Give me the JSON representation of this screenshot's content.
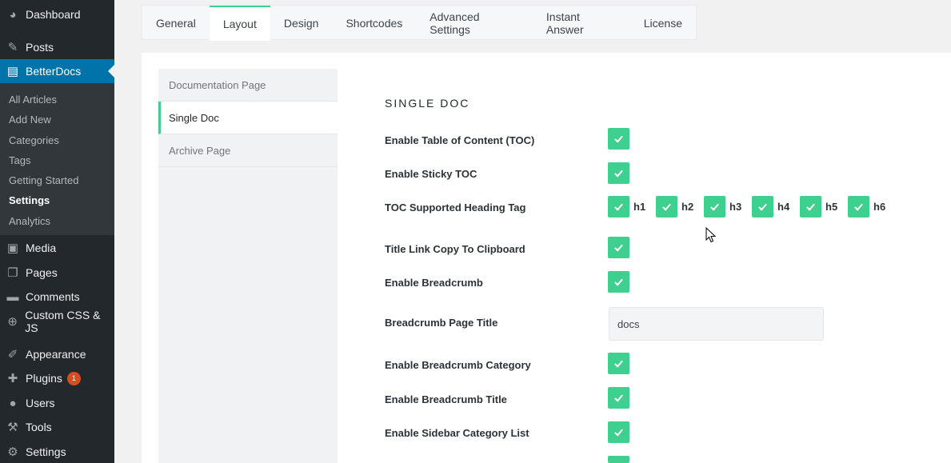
{
  "sidebar": {
    "items": [
      {
        "label": "Dashboard",
        "icon": "dashboard-icon",
        "glyph": "◕"
      },
      {
        "label": "Posts",
        "icon": "pin-icon",
        "glyph": "✎"
      },
      {
        "label": "BetterDocs",
        "icon": "document-icon",
        "glyph": "▤"
      },
      {
        "label": "Media",
        "icon": "media-icon",
        "glyph": "▣"
      },
      {
        "label": "Pages",
        "icon": "pages-icon",
        "glyph": "❐"
      },
      {
        "label": "Comments",
        "icon": "comment-icon",
        "glyph": "▬"
      },
      {
        "label": "Custom CSS & JS",
        "icon": "plus-circle-icon",
        "glyph": "⊕"
      },
      {
        "label": "Appearance",
        "icon": "brush-icon",
        "glyph": "✐"
      },
      {
        "label": "Plugins",
        "icon": "plug-icon",
        "glyph": "✚",
        "badge": "1"
      },
      {
        "label": "Users",
        "icon": "user-icon",
        "glyph": "●"
      },
      {
        "label": "Tools",
        "icon": "wrench-icon",
        "glyph": "⚒"
      },
      {
        "label": "Settings",
        "icon": "settings-icon",
        "glyph": "⚙"
      }
    ],
    "submenu": [
      "All Articles",
      "Add New",
      "Categories",
      "Tags",
      "Getting Started",
      "Settings",
      "Analytics"
    ]
  },
  "tabs": [
    "General",
    "Layout",
    "Design",
    "Shortcodes",
    "Advanced Settings",
    "Instant Answer",
    "License"
  ],
  "subnav": [
    "Documentation Page",
    "Single Doc",
    "Archive Page"
  ],
  "section_title": "SINGLE DOC",
  "rows": {
    "toc": "Enable Table of Content (TOC)",
    "sticky_toc": "Enable Sticky TOC",
    "heading_tag": "TOC Supported Heading Tag",
    "title_link": "Title Link Copy To Clipboard",
    "breadcrumb": "Enable Breadcrumb",
    "breadcrumb_page_title": "Breadcrumb Page Title",
    "breadcrumb_category": "Enable Breadcrumb Category",
    "breadcrumb_title": "Enable Breadcrumb Title",
    "sidebar_category_list": "Enable Sidebar Category List"
  },
  "heading_tags": [
    "h1",
    "h2",
    "h3",
    "h4",
    "h5",
    "h6"
  ],
  "breadcrumb_title_value": "docs",
  "colors": {
    "accent": "#3fd08f",
    "admin_blue": "#0073aa",
    "sidebar": "#23282d"
  }
}
